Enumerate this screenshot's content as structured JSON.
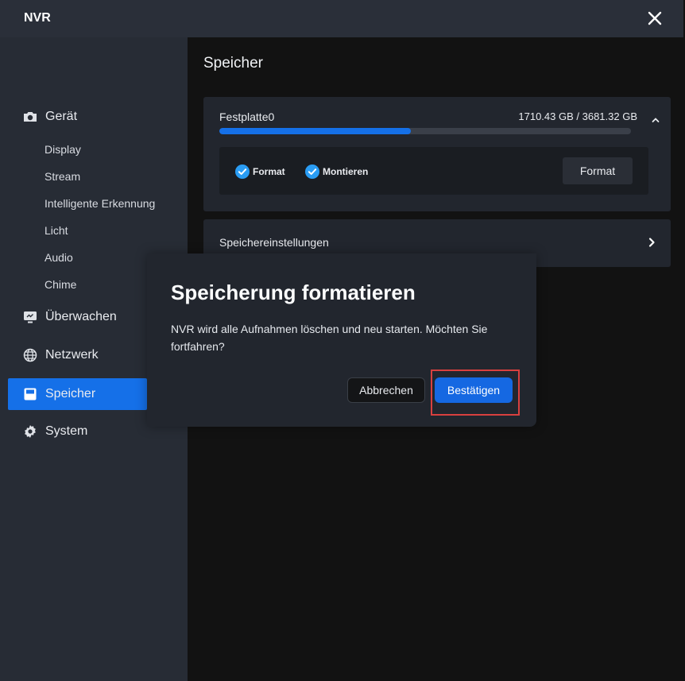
{
  "app": {
    "title": "NVR"
  },
  "sidebar": {
    "items": [
      {
        "label": "Gerät",
        "icon": "camera-icon"
      },
      {
        "label": "Überwachen",
        "icon": "monitor-icon"
      },
      {
        "label": "Netzwerk",
        "icon": "globe-icon"
      },
      {
        "label": "Speicher",
        "icon": "storage-icon",
        "active": true
      },
      {
        "label": "System",
        "icon": "gear-icon"
      }
    ],
    "sub_items": [
      "Display",
      "Stream",
      "Intelligente Erkennung",
      "Licht",
      "Audio",
      "Chime"
    ]
  },
  "main": {
    "title": "Speicher",
    "disk": {
      "name": "Festplatte0",
      "usage": "1710.43 GB / 3681.32 GB",
      "used_fraction": 0.4646,
      "checks": [
        {
          "label": "Format",
          "checked": true
        },
        {
          "label": "Montieren",
          "checked": true
        }
      ],
      "format_button": "Format"
    },
    "settings_label": "Speichereinstellungen"
  },
  "dialog": {
    "title": "Speicherung formatieren",
    "message": "NVR wird alle Aufnahmen löschen und neu starten. Möchten Sie fortfahren?",
    "cancel_label": "Abbrechen",
    "confirm_label": "Bestätigen"
  },
  "colors": {
    "accent": "#1570e8",
    "highlight": "#d9403f",
    "check": "#2a9df4"
  }
}
